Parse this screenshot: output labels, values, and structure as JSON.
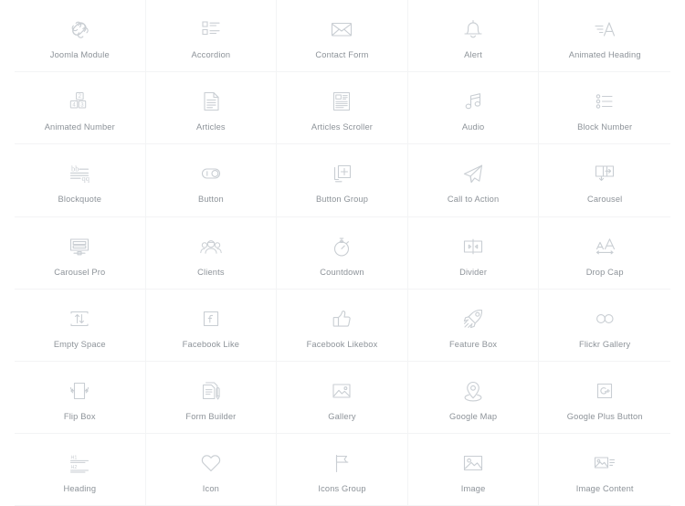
{
  "page": {
    "background_color": "#ffffff",
    "divider_color": "#f3f4f5",
    "icon_stroke_color": "#c9ced3",
    "label_color": "#8d9399",
    "columns": 5
  },
  "elements": [
    {
      "label": "Joomla Module",
      "icon": "joomla-icon"
    },
    {
      "label": "Accordion",
      "icon": "accordion-icon"
    },
    {
      "label": "Contact Form",
      "icon": "envelope-icon"
    },
    {
      "label": "Alert",
      "icon": "bell-icon"
    },
    {
      "label": "Animated Heading",
      "icon": "animated-letter-a-icon"
    },
    {
      "label": "Animated Number",
      "icon": "number-blocks-icon"
    },
    {
      "label": "Articles",
      "icon": "document-lines-icon"
    },
    {
      "label": "Articles Scroller",
      "icon": "newspaper-icon"
    },
    {
      "label": "Audio",
      "icon": "music-note-icon"
    },
    {
      "label": "Block Number",
      "icon": "bullet-list-circles-icon"
    },
    {
      "label": "Blockquote",
      "icon": "quote-lines-icon"
    },
    {
      "label": "Button",
      "icon": "toggle-switch-icon"
    },
    {
      "label": "Button Group",
      "icon": "plus-square-group-icon"
    },
    {
      "label": "Call to Action",
      "icon": "paper-plane-icon"
    },
    {
      "label": "Carousel",
      "icon": "carousel-slide-icon"
    },
    {
      "label": "Carousel Pro",
      "icon": "carousel-pro-icon"
    },
    {
      "label": "Clients",
      "icon": "people-group-icon"
    },
    {
      "label": "Countdown",
      "icon": "stopwatch-icon"
    },
    {
      "label": "Divider",
      "icon": "divider-arrows-icon"
    },
    {
      "label": "Drop Cap",
      "icon": "letters-size-icon"
    },
    {
      "label": "Empty Space",
      "icon": "up-down-arrows-box-icon"
    },
    {
      "label": "Facebook Like",
      "icon": "facebook-square-icon"
    },
    {
      "label": "Facebook Likebox",
      "icon": "thumbs-up-icon"
    },
    {
      "label": "Feature Box",
      "icon": "rocket-icon"
    },
    {
      "label": "Flickr Gallery",
      "icon": "two-circles-icon"
    },
    {
      "label": "Flip Box",
      "icon": "flip-box-icon"
    },
    {
      "label": "Form Builder",
      "icon": "form-pen-icon"
    },
    {
      "label": "Gallery",
      "icon": "picture-frame-icon"
    },
    {
      "label": "Google Map",
      "icon": "map-pin-icon"
    },
    {
      "label": "Google Plus Button",
      "icon": "google-plus-square-icon"
    },
    {
      "label": "Heading",
      "icon": "heading-levels-icon"
    },
    {
      "label": "Icon",
      "icon": "heart-icon"
    },
    {
      "label": "Icons Group",
      "icon": "flag-group-icon"
    },
    {
      "label": "Image",
      "icon": "image-icon"
    },
    {
      "label": "Image Content",
      "icon": "image-text-icon"
    }
  ]
}
